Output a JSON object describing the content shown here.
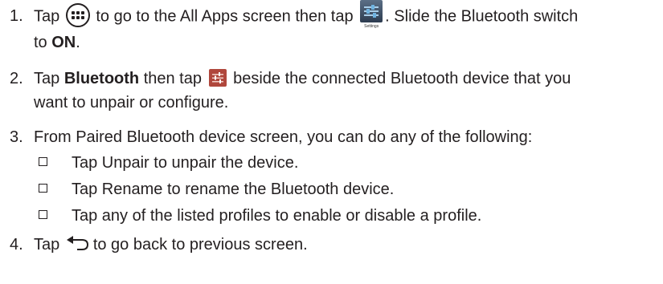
{
  "step1": {
    "number": "1.",
    "text_a": "Tap",
    "text_b": "to go to the All Apps screen then tap",
    "text_c": ". Slide the Bluetooth switch",
    "text_d": "to",
    "on": "ON",
    "period": ".",
    "apps_icon": "all-apps-icon",
    "settings_icon": "settings-app-icon",
    "settings_caption": "Settings"
  },
  "step2": {
    "number": "2.",
    "text_a": "Tap",
    "bluetooth": "Bluetooth",
    "text_b": "then tap",
    "text_c": "beside the connected Bluetooth device that you",
    "text_d": "want to unpair or configure.",
    "config_icon": "bluetooth-config-icon"
  },
  "step3": {
    "number": "3.",
    "text": "From Paired Bluetooth device screen, you can do any of the following:",
    "options": [
      "Tap Unpair to unpair the device.",
      "Tap Rename to rename the Bluetooth device.",
      "Tap any of the listed profiles to enable or disable a profile."
    ]
  },
  "step4": {
    "number": "4.",
    "text_a": "Tap",
    "text_b": "to go back to previous screen.",
    "back_icon": "back-arrow-icon"
  },
  "colors": {
    "text": "#231f20",
    "settings_tile": "#3e5068",
    "config_icon": "#b0473c"
  }
}
